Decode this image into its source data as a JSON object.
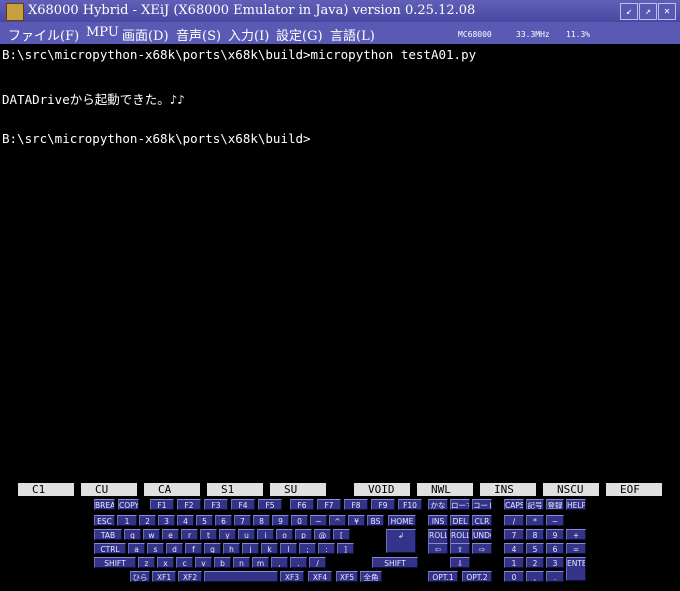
{
  "window": {
    "title": "X68000 Hybrid - XEiJ (X68000 Emulator in Java) version 0.25.12.08",
    "btn_min": "↙",
    "btn_max": "↗",
    "btn_close": "✕"
  },
  "menu": [
    {
      "label": "ファイル(F)"
    },
    {
      "label": "MPU"
    },
    {
      "label": "画面(D)"
    },
    {
      "label": "音声(S)"
    },
    {
      "label": "入力(I)"
    },
    {
      "label": "設定(G)"
    },
    {
      "label": "言語(L)"
    }
  ],
  "status": {
    "cpu": "MC68000",
    "clock": "33.3MHz",
    "load": "11.3%"
  },
  "terminal": {
    "lines": [
      "B:\\src\\micropython-x68k\\ports\\x68k\\build>micropython testA01.py",
      "",
      "DATADriveから起動できた。♪♪",
      "",
      "B:\\src\\micropython-x68k\\ports\\x68k\\build>"
    ]
  },
  "function_bar": [
    "C1",
    "CU",
    "CA",
    "S1",
    "SU",
    "VOID",
    "NWL",
    "INS",
    "NSCU",
    "EOF"
  ],
  "keyboard": {
    "row0": [
      "BREAK",
      "COPY",
      "F1",
      "F2",
      "F3",
      "F4",
      "F5",
      "F6",
      "F7",
      "F8",
      "F9",
      "F10",
      "かな",
      "ローマ",
      "コード",
      "CAPS",
      "記号",
      "登録",
      "HELP"
    ],
    "row1": [
      "ESC",
      "1",
      "2",
      "3",
      "4",
      "5",
      "6",
      "7",
      "8",
      "9",
      "0",
      "−",
      "^",
      "¥",
      "BS",
      "HOME",
      "INS",
      "DEL",
      "CLR",
      "/",
      "*",
      "−"
    ],
    "row2": [
      "TAB",
      "q",
      "w",
      "e",
      "r",
      "t",
      "y",
      "u",
      "i",
      "o",
      "p",
      "@",
      "[",
      "↲",
      "ROLL UP",
      "ROLL DOWN",
      "UNDO",
      "7",
      "8",
      "9",
      "+"
    ],
    "row3": [
      "CTRL",
      "a",
      "s",
      "d",
      "f",
      "g",
      "h",
      "j",
      "k",
      "l",
      ";",
      ":",
      "]",
      "⇦",
      "⇧",
      "⇨",
      "4",
      "5",
      "6",
      "="
    ],
    "row4": [
      "SHIFT",
      "z",
      "x",
      "c",
      "v",
      "b",
      "n",
      "m",
      ",",
      ".",
      "/",
      "SHIFT",
      "⇩",
      "1",
      "2",
      "3",
      "ENTER"
    ],
    "row5": [
      "ひら",
      "XF1",
      "XF2",
      "XF3",
      "XF4",
      "XF5",
      "全角",
      "OPT.1",
      "OPT.2",
      "0",
      ",",
      "."
    ]
  }
}
